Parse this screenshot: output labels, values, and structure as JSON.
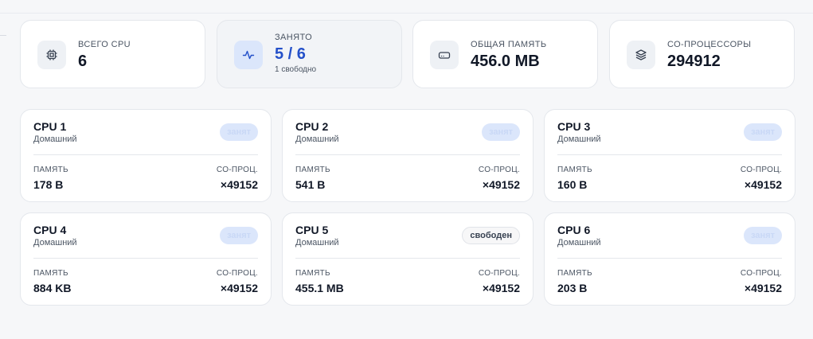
{
  "stats": [
    {
      "label": "ВСЕГО CPU",
      "value": "6",
      "icon": "cpu-chip-icon"
    },
    {
      "label": "ЗАНЯТО",
      "value": "5 / 6",
      "sub": "1 свободно",
      "icon": "activity-pulse-icon"
    },
    {
      "label": "ОБЩАЯ ПАМЯТЬ",
      "value": "456.0 MB",
      "icon": "hard-drive-icon"
    },
    {
      "label": "СО-ПРОЦЕССОРЫ",
      "value": "294912",
      "icon": "layers-icon"
    }
  ],
  "labels": {
    "memory": "ПАМЯТЬ",
    "coproc": "СО-ПРОЦ."
  },
  "cpus": [
    {
      "name": "CPU 1",
      "type": "Домашний",
      "status": "занят",
      "memory": "178 B",
      "coproc": "×49152"
    },
    {
      "name": "CPU 2",
      "type": "Домашний",
      "status": "занят",
      "memory": "541 B",
      "coproc": "×49152"
    },
    {
      "name": "CPU 3",
      "type": "Домашний",
      "status": "занят",
      "memory": "160 B",
      "coproc": "×49152"
    },
    {
      "name": "CPU 4",
      "type": "Домашний",
      "status": "занят",
      "memory": "884 KB",
      "coproc": "×49152"
    },
    {
      "name": "CPU 5",
      "type": "Домашний",
      "status": "свободен",
      "memory": "455.1 MB",
      "coproc": "×49152"
    },
    {
      "name": "CPU 6",
      "type": "Домашний",
      "status": "занят",
      "memory": "203 B",
      "coproc": "×49152"
    }
  ],
  "colors": {
    "accent": "#2450c9",
    "busy_badge_bg": "#dbe6fb"
  }
}
